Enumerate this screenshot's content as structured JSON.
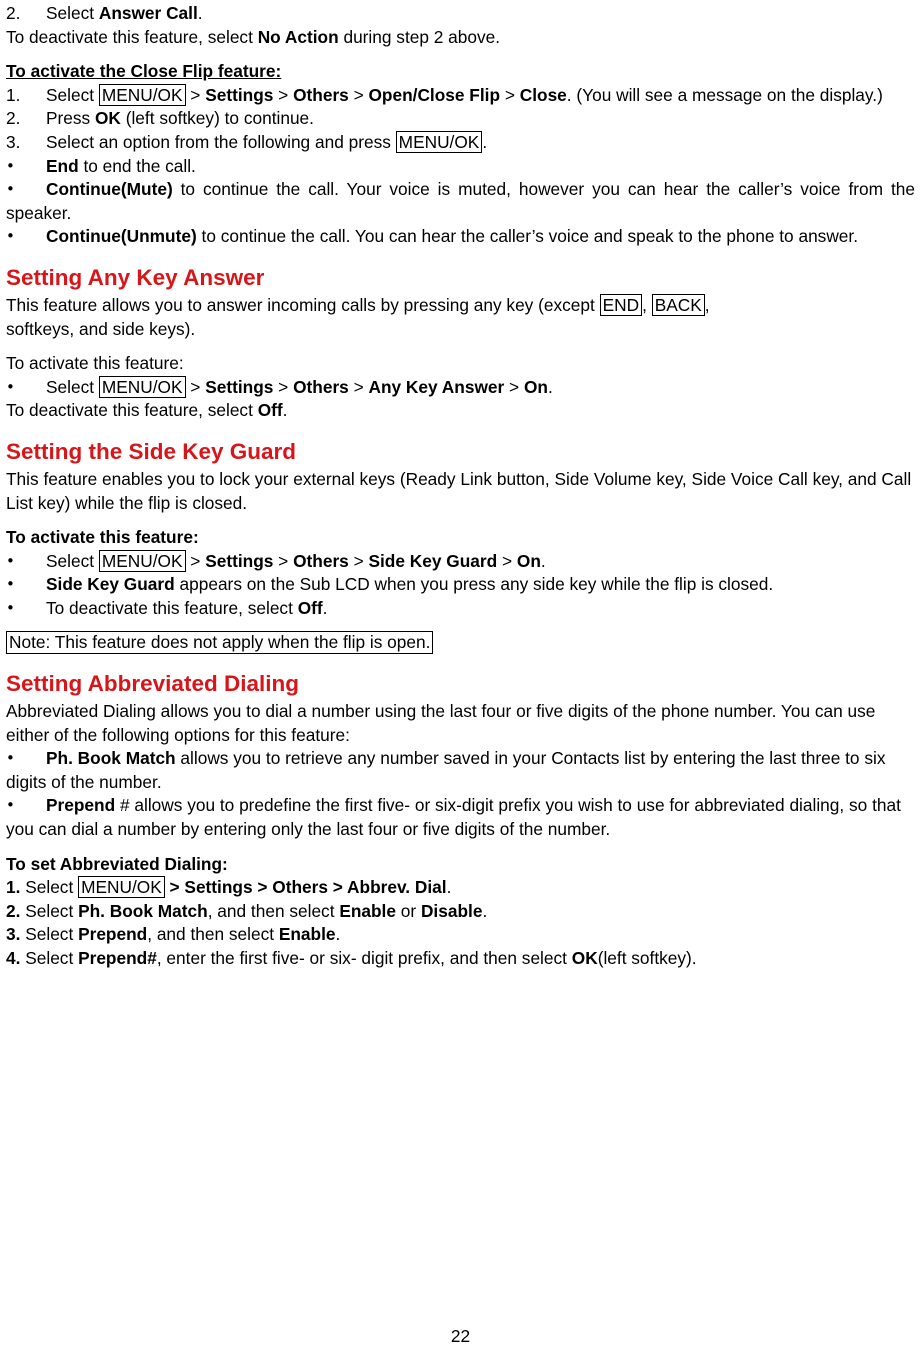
{
  "page": {
    "number": "22"
  },
  "blocks": {
    "step2_answer_call": {
      "marker": "2.",
      "pre": "Select ",
      "bold": "Answer Call",
      "post": "."
    },
    "deactivate_answer_call": {
      "pre": "To deactivate this feature, select ",
      "bold": "No Action",
      "post": " during step 2 above."
    },
    "close_flip_heading": "To activate the Close Flip feature:",
    "close_flip_step1": {
      "marker": "1.",
      "t1": "Select ",
      "key1": "MENU/OK",
      "t2": " > ",
      "b1": "Settings",
      "t3": " > ",
      "b2": "Others",
      "t4": " > ",
      "b3": "Open/Close Flip",
      "t5": " > ",
      "b4": "Close",
      "t6": ". (You will see a message on the display.)"
    },
    "close_flip_step2": {
      "marker": "2.",
      "t1": "Press ",
      "b1": "OK",
      "t2": " (left softkey) to continue."
    },
    "close_flip_step3": {
      "marker": "3.",
      "t1": "Select an option from the following and press ",
      "key1": "MENU/OK",
      "t2": "."
    },
    "bullet_end": {
      "bold": "End",
      "post": " to end the call."
    },
    "bullet_continue_mute": {
      "bold": "Continue(Mute)",
      "post": " to continue the call. Your voice is muted, however you can hear the caller’s voice from the speaker."
    },
    "bullet_continue_unmute": {
      "bold": "Continue(Unmute)",
      "post": " to continue the call. You can hear the caller’s voice and speak to the phone to answer."
    },
    "any_key_heading": "Setting Any Key Answer",
    "any_key_intro_1": "This feature allows you to answer incoming calls by pressing any key (except ",
    "any_key_end": "END",
    "any_key_intro_2": ",  ",
    "any_key_back": "BACK",
    "any_key_intro_3": ",",
    "any_key_intro_4": "softkeys, and side keys).",
    "any_key_activate": "To activate this feature:",
    "any_key_bullet": {
      "t1": "Select ",
      "key1": "MENU/OK",
      "t2": " > ",
      "b1": "Settings",
      "t3": " > ",
      "b2": "Others",
      "t4": " > ",
      "b3": "Any Key Answer",
      "t5": " > ",
      "b4": "On",
      "t6": "."
    },
    "any_key_deactivate": {
      "pre": "To deactivate this feature, select ",
      "bold": "Off",
      "post": "."
    },
    "side_key_heading": "Setting the Side Key Guard",
    "side_key_intro": "This feature enables you to lock your external keys (Ready Link button, Side Volume key, Side Voice Call key, and Call List key) while the flip is closed.",
    "side_key_activate": "To activate this feature:",
    "side_key_bullet1": {
      "t1": "Select ",
      "key1": "MENU/OK",
      "t2": " > ",
      "b1": "Settings",
      "t3": " > ",
      "b2": "Others",
      "t4": " > ",
      "b3": "Side Key Guard",
      "t5": " > ",
      "b4": "On",
      "t6": "."
    },
    "side_key_bullet2": {
      "bold": "Side Key Guard",
      "post": " appears on the Sub LCD when you press any side key while the flip is closed."
    },
    "side_key_bullet3": {
      "pre": "To deactivate this feature, select ",
      "bold": "Off",
      "post": "."
    },
    "side_key_note": "Note: This feature does not apply when the flip is open.",
    "abbrev_heading": "Setting Abbreviated Dialing",
    "abbrev_intro": "Abbreviated Dialing allows you to dial a number using the last four or five digits of the phone number. You can use either of the following options for this feature:",
    "abbrev_bullet1": {
      "bold": "Ph. Book Match",
      "post": " allows you to retrieve any number saved in your Contacts list by entering the last three to six digits of the number."
    },
    "abbrev_bullet2": {
      "bold": "Prepend",
      "post": " # allows you to predefine the first five- or six-digit prefix you wish to use for abbreviated dialing, so that you can dial a number by entering only the last four or five digits of the number."
    },
    "abbrev_set_heading": "To set Abbreviated Dialing:",
    "abbrev_step1": {
      "marker": "1.",
      "t1": " Select ",
      "key1": "MENU/OK",
      "t2": " > Settings > Others > Abbrev. Dial",
      "t3": "."
    },
    "abbrev_step2": {
      "marker": "2.",
      "t1": " Select ",
      "b1": "Ph. Book Match",
      "t2": ", and then select ",
      "b2": "Enable",
      "t3": " or ",
      "b3": "Disable",
      "t4": "."
    },
    "abbrev_step3": {
      "marker": "3.",
      "t1": " Select ",
      "b1": "Prepend",
      "t2": ", and then select ",
      "b2": "Enable",
      "t3": "."
    },
    "abbrev_step4": {
      "marker": "4.",
      "t1": " Select ",
      "b1": "Prepend#",
      "t2": ", enter the first five- or six- digit prefix, and then select ",
      "b2": "OK",
      "t3": "(left softkey)."
    }
  }
}
